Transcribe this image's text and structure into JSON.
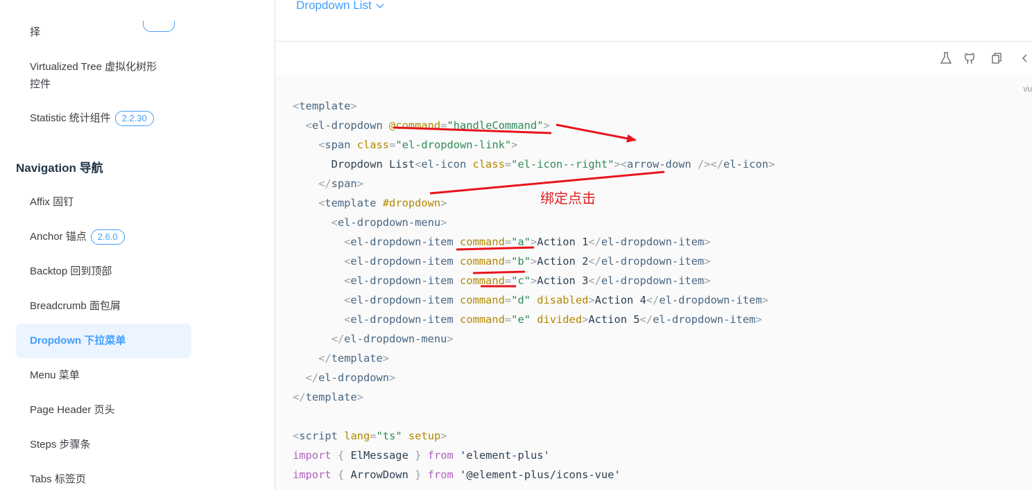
{
  "sidebar": {
    "cut_item": "择",
    "items": [
      {
        "label": "Virtualized Tree 虚拟化树形",
        "label2": "控件"
      },
      {
        "label": "Statistic 统计组件",
        "badge": "2.2.30"
      },
      {
        "label": "Affix 固钉"
      },
      {
        "label": "Anchor 锚点",
        "badge": "2.6.0"
      },
      {
        "label": "Backtop 回到顶部"
      },
      {
        "label": "Breadcrumb 面包屑"
      },
      {
        "label": "Dropdown 下拉菜单",
        "active": true
      },
      {
        "label": "Menu 菜单"
      },
      {
        "label": "Page Header 页头"
      },
      {
        "label": "Steps 步骤条"
      },
      {
        "label": "Tabs 标签页"
      }
    ],
    "section_title": "Navigation 导航"
  },
  "demo": {
    "trigger_label": "Dropdown List",
    "trigger_icon": "chevron-down-icon"
  },
  "toolbar": {
    "icons": [
      "flask-icon",
      "github-icon",
      "copy-icon",
      "code-icon"
    ],
    "lang_tag": "vu"
  },
  "annotation": {
    "text": "绑定点击",
    "color": "#e02020"
  },
  "colors": {
    "accent": "#409eff",
    "active_bg": "#ecf5ff",
    "code_bg": "#fafafa"
  },
  "code_lines": [
    [
      [
        "p",
        "<"
      ],
      [
        "t",
        "template"
      ],
      [
        "p",
        ">"
      ]
    ],
    [
      [
        "x",
        "  "
      ],
      [
        "p",
        "<"
      ],
      [
        "t",
        "el-dropdown"
      ],
      [
        "x",
        " "
      ],
      [
        "a",
        "@command"
      ],
      [
        "p",
        "="
      ],
      [
        "s",
        "\"handleCommand\""
      ],
      [
        "p",
        ">"
      ]
    ],
    [
      [
        "x",
        "    "
      ],
      [
        "p",
        "<"
      ],
      [
        "t",
        "span"
      ],
      [
        "x",
        " "
      ],
      [
        "a",
        "class"
      ],
      [
        "p",
        "="
      ],
      [
        "s",
        "\"el-dropdown-link\""
      ],
      [
        "p",
        ">"
      ]
    ],
    [
      [
        "x",
        "      Dropdown List"
      ],
      [
        "p",
        "<"
      ],
      [
        "t",
        "el-icon"
      ],
      [
        "x",
        " "
      ],
      [
        "a",
        "class"
      ],
      [
        "p",
        "="
      ],
      [
        "s",
        "\"el-icon--right\""
      ],
      [
        "p",
        ">"
      ],
      [
        "p",
        "<"
      ],
      [
        "t",
        "arrow-down"
      ],
      [
        "x",
        " "
      ],
      [
        "p",
        "/>"
      ],
      [
        "p",
        "</"
      ],
      [
        "t",
        "el-icon"
      ],
      [
        "p",
        ">"
      ]
    ],
    [
      [
        "x",
        "    "
      ],
      [
        "p",
        "</"
      ],
      [
        "t",
        "span"
      ],
      [
        "p",
        ">"
      ]
    ],
    [
      [
        "x",
        "    "
      ],
      [
        "p",
        "<"
      ],
      [
        "t",
        "template"
      ],
      [
        "x",
        " "
      ],
      [
        "a",
        "#dropdown"
      ],
      [
        "p",
        ">"
      ]
    ],
    [
      [
        "x",
        "      "
      ],
      [
        "p",
        "<"
      ],
      [
        "t",
        "el-dropdown-menu"
      ],
      [
        "p",
        ">"
      ]
    ],
    [
      [
        "x",
        "        "
      ],
      [
        "p",
        "<"
      ],
      [
        "t",
        "el-dropdown-item"
      ],
      [
        "x",
        " "
      ],
      [
        "a",
        "command"
      ],
      [
        "p",
        "="
      ],
      [
        "s",
        "\"a\""
      ],
      [
        "p",
        ">"
      ],
      [
        "x",
        "Action 1"
      ],
      [
        "p",
        "</"
      ],
      [
        "t",
        "el-dropdown-item"
      ],
      [
        "p",
        ">"
      ]
    ],
    [
      [
        "x",
        "        "
      ],
      [
        "p",
        "<"
      ],
      [
        "t",
        "el-dropdown-item"
      ],
      [
        "x",
        " "
      ],
      [
        "a",
        "command"
      ],
      [
        "p",
        "="
      ],
      [
        "s",
        "\"b\""
      ],
      [
        "p",
        ">"
      ],
      [
        "x",
        "Action 2"
      ],
      [
        "p",
        "</"
      ],
      [
        "t",
        "el-dropdown-item"
      ],
      [
        "p",
        ">"
      ]
    ],
    [
      [
        "x",
        "        "
      ],
      [
        "p",
        "<"
      ],
      [
        "t",
        "el-dropdown-item"
      ],
      [
        "x",
        " "
      ],
      [
        "a",
        "command"
      ],
      [
        "p",
        "="
      ],
      [
        "s",
        "\"c\""
      ],
      [
        "p",
        ">"
      ],
      [
        "x",
        "Action 3"
      ],
      [
        "p",
        "</"
      ],
      [
        "t",
        "el-dropdown-item"
      ],
      [
        "p",
        ">"
      ]
    ],
    [
      [
        "x",
        "        "
      ],
      [
        "p",
        "<"
      ],
      [
        "t",
        "el-dropdown-item"
      ],
      [
        "x",
        " "
      ],
      [
        "a",
        "command"
      ],
      [
        "p",
        "="
      ],
      [
        "s",
        "\"d\""
      ],
      [
        "x",
        " "
      ],
      [
        "a",
        "disabled"
      ],
      [
        "p",
        ">"
      ],
      [
        "x",
        "Action 4"
      ],
      [
        "p",
        "</"
      ],
      [
        "t",
        "el-dropdown-item"
      ],
      [
        "p",
        ">"
      ]
    ],
    [
      [
        "x",
        "        "
      ],
      [
        "p",
        "<"
      ],
      [
        "t",
        "el-dropdown-item"
      ],
      [
        "x",
        " "
      ],
      [
        "a",
        "command"
      ],
      [
        "p",
        "="
      ],
      [
        "s",
        "\"e\""
      ],
      [
        "x",
        " "
      ],
      [
        "a",
        "divided"
      ],
      [
        "p",
        ">"
      ],
      [
        "x",
        "Action 5"
      ],
      [
        "p",
        "</"
      ],
      [
        "t",
        "el-dropdown-item"
      ],
      [
        "p",
        ">"
      ]
    ],
    [
      [
        "x",
        "      "
      ],
      [
        "p",
        "</"
      ],
      [
        "t",
        "el-dropdown-menu"
      ],
      [
        "p",
        ">"
      ]
    ],
    [
      [
        "x",
        "    "
      ],
      [
        "p",
        "</"
      ],
      [
        "t",
        "template"
      ],
      [
        "p",
        ">"
      ]
    ],
    [
      [
        "x",
        "  "
      ],
      [
        "p",
        "</"
      ],
      [
        "t",
        "el-dropdown"
      ],
      [
        "p",
        ">"
      ]
    ],
    [
      [
        "p",
        "</"
      ],
      [
        "t",
        "template"
      ],
      [
        "p",
        ">"
      ]
    ],
    [
      [
        "x",
        ""
      ]
    ],
    [
      [
        "p",
        "<"
      ],
      [
        "t",
        "script"
      ],
      [
        "x",
        " "
      ],
      [
        "a",
        "lang"
      ],
      [
        "p",
        "="
      ],
      [
        "s",
        "\"ts\""
      ],
      [
        "x",
        " "
      ],
      [
        "a",
        "setup"
      ],
      [
        "p",
        ">"
      ]
    ],
    [
      [
        "k",
        "import"
      ],
      [
        "x",
        " "
      ],
      [
        "p",
        "{"
      ],
      [
        "x",
        " ElMessage "
      ],
      [
        "p",
        "}"
      ],
      [
        "x",
        " "
      ],
      [
        "k",
        "from"
      ],
      [
        "x",
        " "
      ],
      [
        "x",
        "'element-plus'"
      ]
    ],
    [
      [
        "k",
        "import"
      ],
      [
        "x",
        " "
      ],
      [
        "p",
        "{"
      ],
      [
        "x",
        " ArrowDown "
      ],
      [
        "p",
        "}"
      ],
      [
        "x",
        " "
      ],
      [
        "k",
        "from"
      ],
      [
        "x",
        " "
      ],
      [
        "x",
        "'@element-plus/icons-vue'"
      ]
    ]
  ]
}
